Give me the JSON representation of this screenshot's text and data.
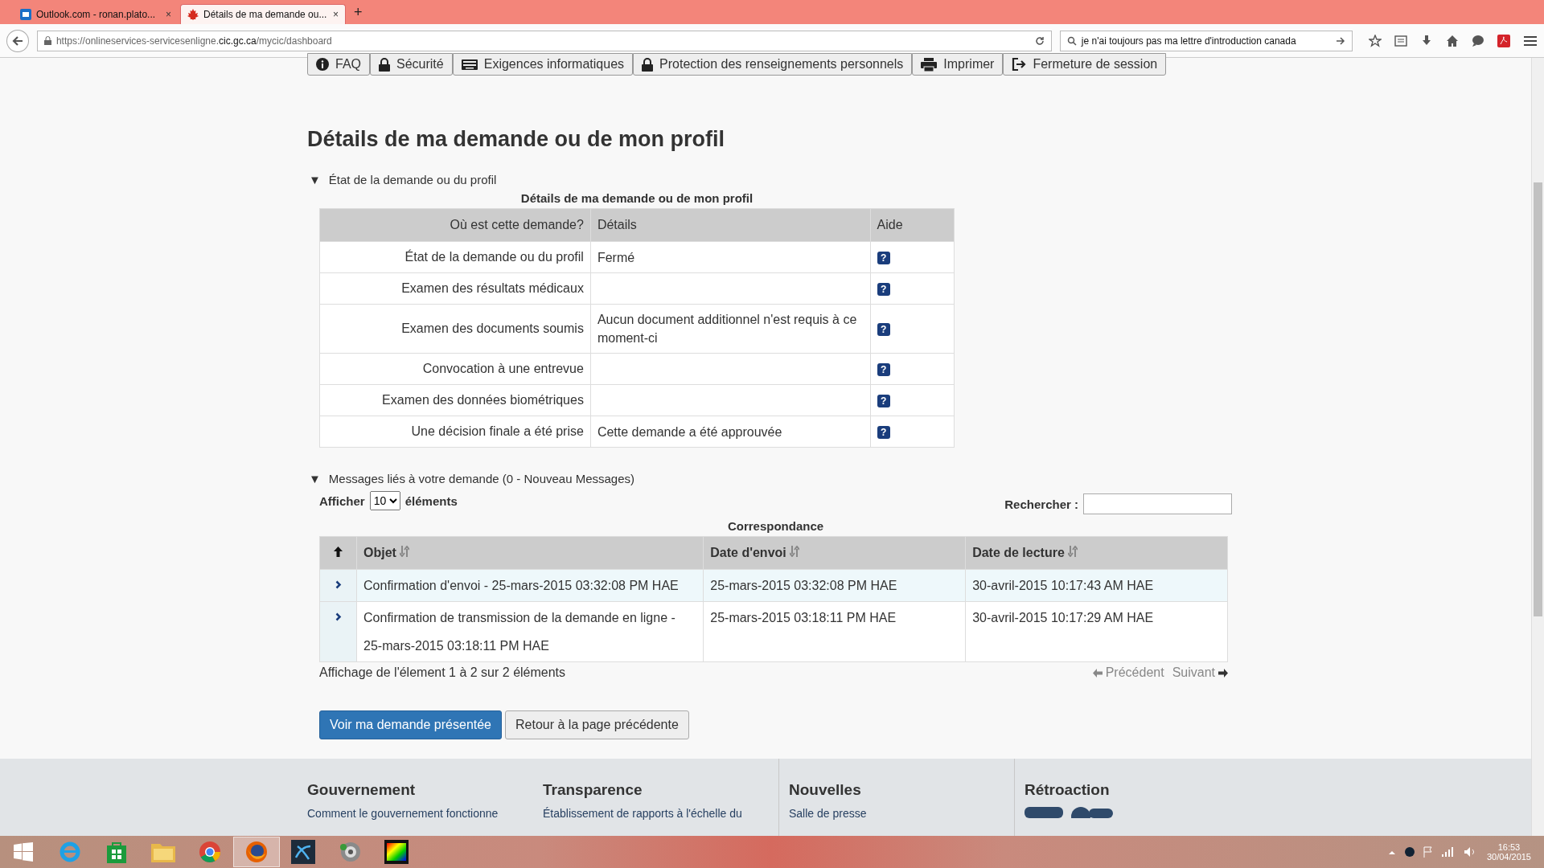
{
  "browser": {
    "tabs": [
      {
        "label": "Outlook.com - ronan.plato...",
        "close": "×",
        "selected": false
      },
      {
        "label": "Détails de ma demande ou...",
        "close": "×",
        "selected": true
      }
    ],
    "new_tab": "+",
    "url_prefix": "https://onlineservices-servicesenligne.",
    "url_domain": "cic.gc.ca",
    "url_path": "/mycic/dashboard",
    "search_value": "je n'ai toujours pas ma lettre d'introduction canada"
  },
  "site_nav": [
    {
      "label": "FAQ"
    },
    {
      "label": "Sécurité"
    },
    {
      "label": "Exigences informatiques"
    },
    {
      "label": "Protection des renseignements personnels"
    },
    {
      "label": "Imprimer"
    },
    {
      "label": "Fermeture de session"
    }
  ],
  "heading": "Détails de ma demande ou de mon profil",
  "status_section": {
    "toggle": "▼",
    "title": "État de la demande ou du profil",
    "expanded": true,
    "caption": "Détails de ma demande ou de mon profil",
    "columns": [
      "Où est cette demande?",
      "Détails",
      "Aide"
    ],
    "rows": [
      {
        "step": "État de la demande ou du profil",
        "details": "Fermé",
        "help": "?"
      },
      {
        "step": "Examen des résultats médicaux",
        "help": "?"
      },
      {
        "step": "Examen des documents soumis",
        "details": "Aucun document additionnel n'est requis à ce moment-ci",
        "help": "?"
      },
      {
        "step": "Convocation à une entrevue",
        "help": "?"
      },
      {
        "step": "Examen des données biométriques",
        "help": "?"
      },
      {
        "step": "Une décision finale a été prise",
        "details": "Cette demande a été approuvée",
        "help": "?"
      }
    ]
  },
  "messages_section": {
    "toggle": "▼",
    "title": "Messages liés à votre demande (0 - Nouveau Messages)",
    "expanded": true,
    "show_label": "Afficher",
    "page_size": "10",
    "page_size_suffix": "éléments",
    "search_label": "Rechercher :",
    "caption": "Correspondance",
    "columns": [
      {
        "label": "Objet"
      },
      {
        "label": "Date d'envoi"
      },
      {
        "label": "Date de lecture"
      }
    ],
    "rows": [
      {
        "subject": "Confirmation d'envoi - 25-mars-2015 03:32:08 PM HAE",
        "sent": "25-mars-2015 03:32:08 PM HAE",
        "read": "30-avril-2015 10:17:43 AM HAE",
        "highlighted": true
      },
      {
        "subject": "Confirmation de transmission de la demande en ligne - 25-mars-2015 03:18:11 PM HAE",
        "sent": "25-mars-2015 03:18:11 PM HAE",
        "read": "30-avril-2015 10:17:29 AM HAE",
        "highlighted": false
      }
    ],
    "info": "Affichage de l'élement 1 à 2 sur 2 éléments",
    "previous": "Précédent",
    "next": "Suivant"
  },
  "buttons": [
    {
      "label": "Voir ma demande présentée",
      "kind": "primary"
    },
    {
      "label": "Retour à la page précédente",
      "kind": "default"
    }
  ],
  "footer": [
    {
      "title": "Gouvernement",
      "link": "Comment le gouvernement fonctionne"
    },
    {
      "title": "Transparence",
      "link": "Établissement de rapports à l'échelle du"
    },
    {
      "title": "Nouvelles",
      "link": "Salle de presse"
    },
    {
      "title": "Rétroaction"
    }
  ],
  "taskbar": {
    "apps": [
      {
        "selected": false
      },
      {
        "selected": false
      },
      {
        "selected": false
      },
      {
        "selected": false
      },
      {
        "selected": true
      },
      {
        "selected": false
      },
      {
        "selected": false
      },
      {
        "selected": false
      }
    ],
    "time": "16:53",
    "date": "30/04/2015"
  }
}
